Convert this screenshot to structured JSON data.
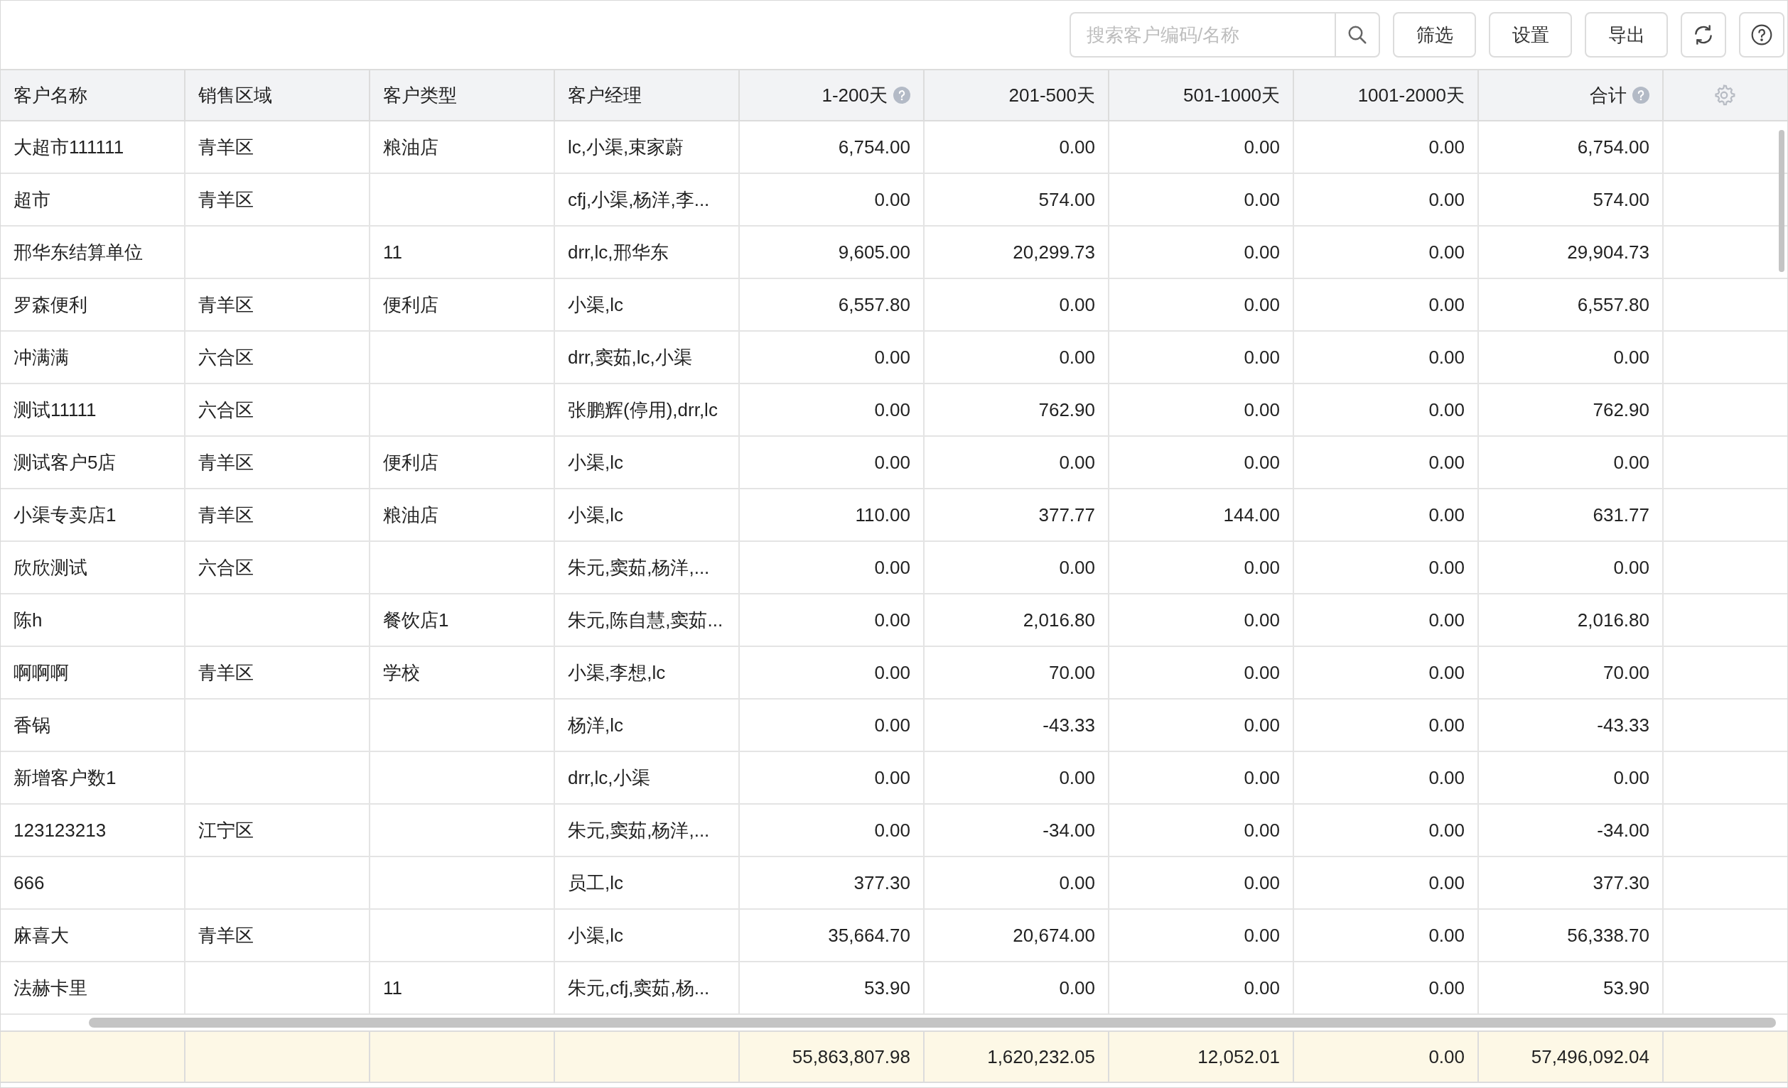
{
  "toolbar": {
    "search": {
      "placeholder": "搜索客户编码/名称"
    },
    "buttons": [
      "筛选",
      "设置",
      "导出"
    ]
  },
  "table": {
    "columns": [
      {
        "label": "客户名称",
        "kind": "text",
        "help": false
      },
      {
        "label": "销售区域",
        "kind": "text",
        "help": false
      },
      {
        "label": "客户类型",
        "kind": "text",
        "help": false
      },
      {
        "label": "客户经理",
        "kind": "text",
        "help": false
      },
      {
        "label": "1-200天",
        "kind": "number",
        "help": true
      },
      {
        "label": "201-500天",
        "kind": "number",
        "help": false
      },
      {
        "label": "501-1000天",
        "kind": "number",
        "help": false
      },
      {
        "label": "1001-2000天",
        "kind": "number",
        "help": false
      },
      {
        "label": "合计",
        "kind": "number",
        "help": true
      }
    ],
    "rows": [
      [
        "大超市111111",
        "青羊区",
        "粮油店",
        "lc,小渠,束家蔚",
        "6,754.00",
        "0.00",
        "0.00",
        "0.00",
        "6,754.00"
      ],
      [
        "超市",
        "青羊区",
        null,
        "cfj,小渠,杨洋,李...",
        "0.00",
        "574.00",
        "0.00",
        "0.00",
        "574.00"
      ],
      [
        "邢华东结算单位",
        null,
        "11",
        "drr,lc,邢华东",
        "9,605.00",
        "20,299.73",
        "0.00",
        "0.00",
        "29,904.73"
      ],
      [
        "罗森便利",
        "青羊区",
        "便利店",
        "小渠,lc",
        "6,557.80",
        "0.00",
        "0.00",
        "0.00",
        "6,557.80"
      ],
      [
        "冲满满",
        "六合区",
        null,
        "drr,窦茹,lc,小渠",
        "0.00",
        "0.00",
        "0.00",
        "0.00",
        "0.00"
      ],
      [
        "测试11111",
        "六合区",
        null,
        "张鹏辉(停用),drr,lc",
        "0.00",
        "762.90",
        "0.00",
        "0.00",
        "762.90"
      ],
      [
        "测试客户5店",
        "青羊区",
        "便利店",
        "小渠,lc",
        "0.00",
        "0.00",
        "0.00",
        "0.00",
        "0.00"
      ],
      [
        "小渠专卖店1",
        "青羊区",
        "粮油店",
        "小渠,lc",
        "110.00",
        "377.77",
        "144.00",
        "0.00",
        "631.77"
      ],
      [
        "欣欣测试",
        "六合区",
        null,
        "朱元,窦茹,杨洋,...",
        "0.00",
        "0.00",
        "0.00",
        "0.00",
        "0.00"
      ],
      [
        "陈h",
        null,
        "餐饮店1",
        "朱元,陈自慧,窦茹...",
        "0.00",
        "2,016.80",
        "0.00",
        "0.00",
        "2,016.80"
      ],
      [
        "啊啊啊",
        "青羊区",
        "学校",
        "小渠,李想,lc",
        "0.00",
        "70.00",
        "0.00",
        "0.00",
        "70.00"
      ],
      [
        "香锅",
        null,
        null,
        "杨洋,lc",
        "0.00",
        "-43.33",
        "0.00",
        "0.00",
        "-43.33"
      ],
      [
        "新增客户数1",
        null,
        null,
        "drr,lc,小渠",
        "0.00",
        "0.00",
        "0.00",
        "0.00",
        "0.00"
      ],
      [
        "123123213",
        "江宁区",
        null,
        "朱元,窦茹,杨洋,...",
        "0.00",
        "-34.00",
        "0.00",
        "0.00",
        "-34.00"
      ],
      [
        "666",
        null,
        null,
        "员工,lc",
        "377.30",
        "0.00",
        "0.00",
        "0.00",
        "377.30"
      ],
      [
        "麻喜大",
        "青羊区",
        null,
        "小渠,lc",
        "35,664.70",
        "20,674.00",
        "0.00",
        "0.00",
        "56,338.70"
      ],
      [
        "法赫卡里",
        null,
        "11",
        "朱元,cfj,窦茹,杨...",
        "53.90",
        "0.00",
        "0.00",
        "0.00",
        "53.90"
      ]
    ],
    "totals": [
      "55,863,807.98",
      "1,620,232.05",
      "12,052.01",
      "0.00",
      "57,496,092.04"
    ]
  }
}
